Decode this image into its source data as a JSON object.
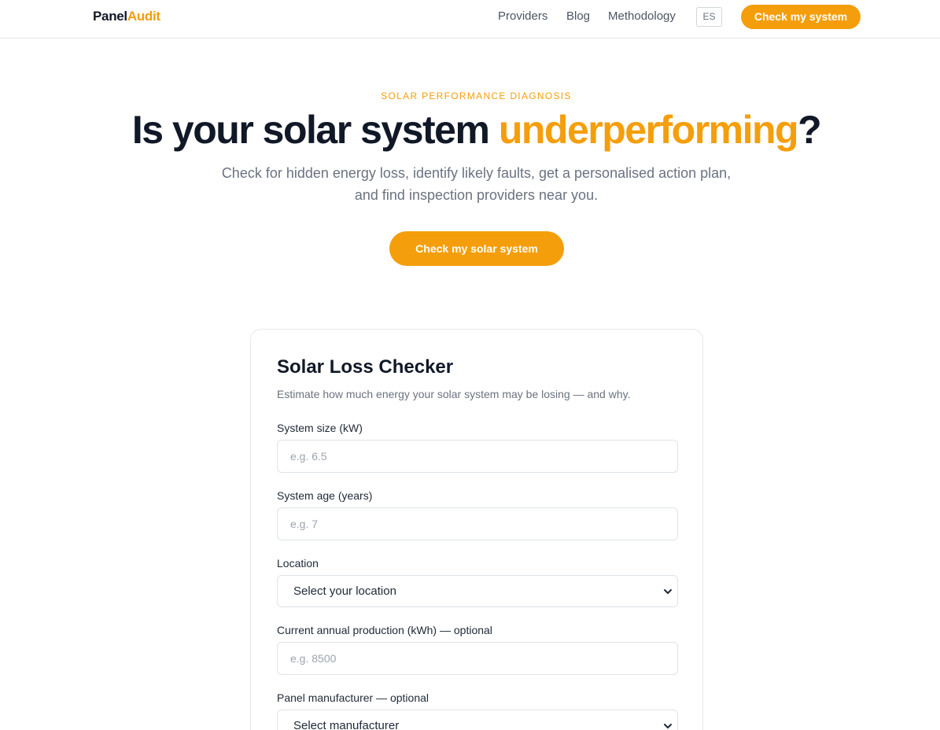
{
  "header": {
    "logo_part1": "Panel",
    "logo_part2": "Audit",
    "nav": {
      "providers": "Providers",
      "blog": "Blog",
      "methodology": "Methodology"
    },
    "lang": "ES",
    "cta": "Check my system"
  },
  "hero": {
    "eyebrow": "SOLAR PERFORMANCE DIAGNOSIS",
    "title_start": "Is your solar system ",
    "title_accent": "underperforming",
    "title_end": "?",
    "subtitle": "Check for hidden energy loss, identify likely faults, get a personalised action plan, and find inspection providers near you.",
    "cta": "Check my solar system"
  },
  "checker": {
    "title": "Solar Loss Checker",
    "subtitle": "Estimate how much energy your solar system may be losing — and why.",
    "fields": {
      "size_label": "System size (kW)",
      "size_placeholder": "e.g. 6.5",
      "age_label": "System age (years)",
      "age_placeholder": "e.g. 7",
      "location_label": "Location",
      "location_value": "Select your location",
      "production_label": "Current annual production (kWh) — optional",
      "production_placeholder": "e.g. 8500",
      "manufacturer_label": "Panel manufacturer — optional",
      "manufacturer_value": "Select manufacturer"
    }
  },
  "colors": {
    "accent": "#f59e0b",
    "text_dark": "#111827",
    "text_muted": "#6b7280"
  },
  "icons": {
    "select_chevron": "chevron-down-icon"
  }
}
